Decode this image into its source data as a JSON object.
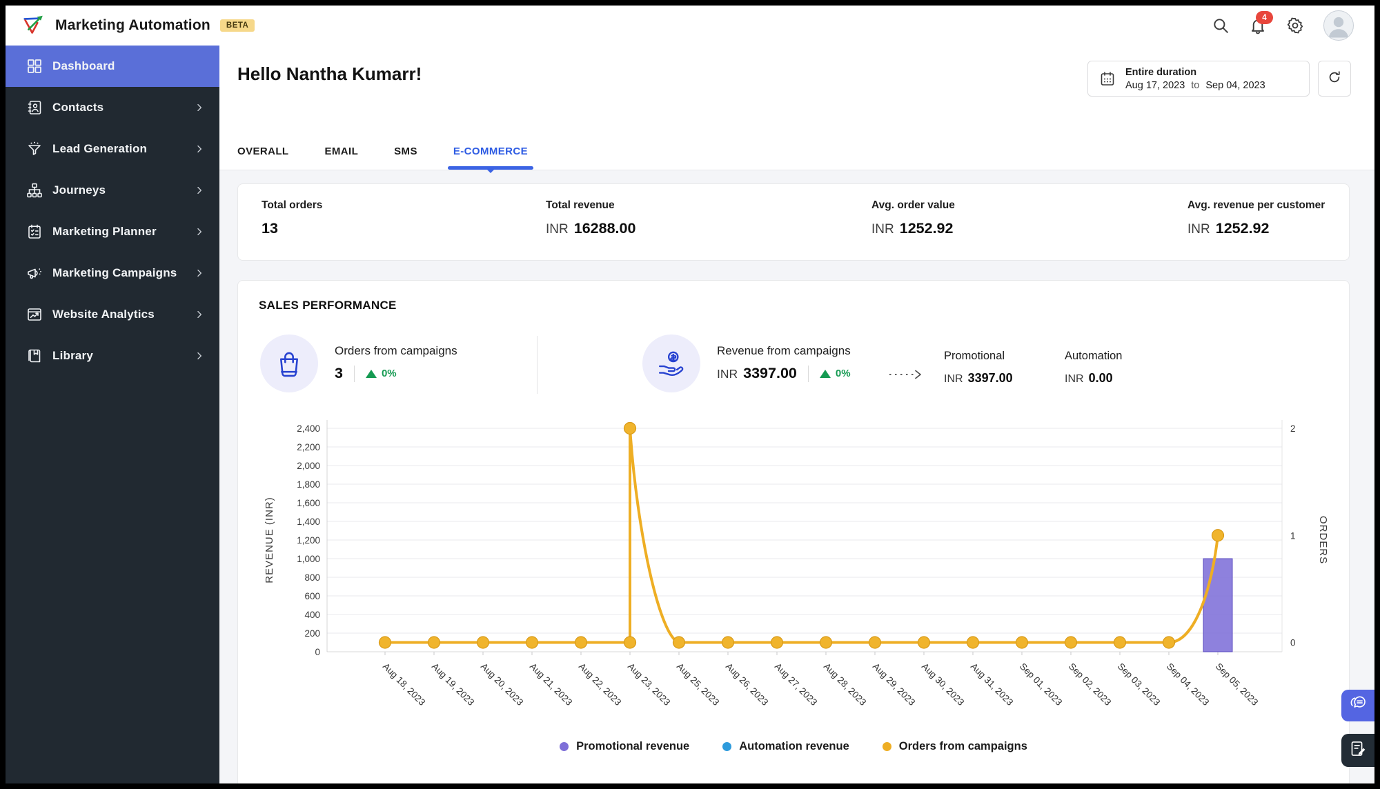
{
  "app": {
    "title": "Marketing Automation",
    "badge": "BETA"
  },
  "topbar": {
    "notification_count": "4"
  },
  "sidebar": {
    "items": [
      {
        "label": "Dashboard",
        "icon": "dashboard",
        "active": true,
        "has_children": false
      },
      {
        "label": "Contacts",
        "icon": "contacts",
        "active": false,
        "has_children": true
      },
      {
        "label": "Lead Generation",
        "icon": "lead-generation",
        "active": false,
        "has_children": true
      },
      {
        "label": "Journeys",
        "icon": "journeys",
        "active": false,
        "has_children": true
      },
      {
        "label": "Marketing Planner",
        "icon": "marketing-planner",
        "active": false,
        "has_children": true
      },
      {
        "label": "Marketing Campaigns",
        "icon": "marketing-campaigns",
        "active": false,
        "has_children": true
      },
      {
        "label": "Website Analytics",
        "icon": "website-analytics",
        "active": false,
        "has_children": true
      },
      {
        "label": "Library",
        "icon": "library",
        "active": false,
        "has_children": true
      }
    ]
  },
  "header": {
    "greeting": "Hello Nantha Kumarr!",
    "date_range": {
      "label": "Entire duration",
      "start": "Aug 17, 2023",
      "to_label": "to",
      "end": "Sep 04, 2023"
    }
  },
  "tabs": [
    {
      "label": "OVERALL",
      "active": false
    },
    {
      "label": "EMAIL",
      "active": false
    },
    {
      "label": "SMS",
      "active": false
    },
    {
      "label": "E-COMMERCE",
      "active": true
    }
  ],
  "summary_stats": [
    {
      "label": "Total orders",
      "value": "13"
    },
    {
      "label": "Total revenue",
      "currency": "INR",
      "value": "16288.00"
    },
    {
      "label": "Avg. order value",
      "currency": "INR",
      "value": "1252.92"
    },
    {
      "label": "Avg. revenue per customer",
      "currency": "INR",
      "value": "1252.92"
    }
  ],
  "sales_performance": {
    "title": "SALES PERFORMANCE",
    "kpis": [
      {
        "label": "Orders from campaigns",
        "value": "3",
        "change": "0%"
      },
      {
        "label": "Revenue from campaigns",
        "currency": "INR",
        "value": "3397.00",
        "change": "0%"
      }
    ],
    "breakdown": [
      {
        "label": "Promotional",
        "currency": "INR",
        "value": "3397.00"
      },
      {
        "label": "Automation",
        "currency": "INR",
        "value": "0.00"
      }
    ]
  },
  "chart_data": {
    "type": "bar+line",
    "categories": [
      "Aug 18, 2023",
      "Aug 19, 2023",
      "Aug 20, 2023",
      "Aug 21, 2023",
      "Aug 22, 2023",
      "Aug 23, 2023",
      "Aug 25, 2023",
      "Aug 26, 2023",
      "Aug 27, 2023",
      "Aug 28, 2023",
      "Aug 29, 2023",
      "Aug 30, 2023",
      "Aug 31, 2023",
      "Sep 01, 2023",
      "Sep 02, 2023",
      "Sep 03, 2023",
      "Sep 04, 2023",
      "Sep 05, 2023"
    ],
    "series": [
      {
        "name": "Promotional revenue",
        "type": "bar",
        "axis": "left",
        "color": "#7e6fd8",
        "values": [
          0,
          0,
          0,
          0,
          0,
          0,
          0,
          0,
          0,
          0,
          0,
          0,
          0,
          0,
          0,
          0,
          0,
          1000
        ]
      },
      {
        "name": "Automation revenue",
        "type": "bar",
        "axis": "left",
        "color": "#2d9bdc",
        "values": [
          0,
          0,
          0,
          0,
          0,
          0,
          0,
          0,
          0,
          0,
          0,
          0,
          0,
          0,
          0,
          0,
          0,
          0
        ]
      },
      {
        "name": "Orders from campaigns",
        "type": "line",
        "axis": "right",
        "color": "#eeae24",
        "values": [
          0,
          0,
          0,
          0,
          0,
          2,
          0,
          0,
          0,
          0,
          0,
          0,
          0,
          0,
          0,
          0,
          0,
          1
        ]
      }
    ],
    "ylabel_left": "REVENUE (INR)",
    "ylabel_right": "ORDERS",
    "yticks_left": [
      0,
      200,
      400,
      600,
      800,
      1000,
      1200,
      1400,
      1600,
      1800,
      2000,
      2200,
      2400
    ],
    "yticks_right": [
      0,
      1,
      2
    ],
    "ylim_left": [
      0,
      2400
    ],
    "ylim_right": [
      0,
      2
    ],
    "grid": true,
    "legend_position": "bottom"
  },
  "colors": {
    "accent": "#2d5be3",
    "sidebar_active": "#5a6fd8",
    "positive": "#159a52",
    "promotional": "#7e6fd8",
    "automation": "#2d9bdc",
    "orders_line": "#eeae24"
  },
  "floating_buttons": [
    {
      "name": "chat",
      "color": "#5465e2"
    },
    {
      "name": "feedback",
      "color": "#222c35"
    }
  ]
}
